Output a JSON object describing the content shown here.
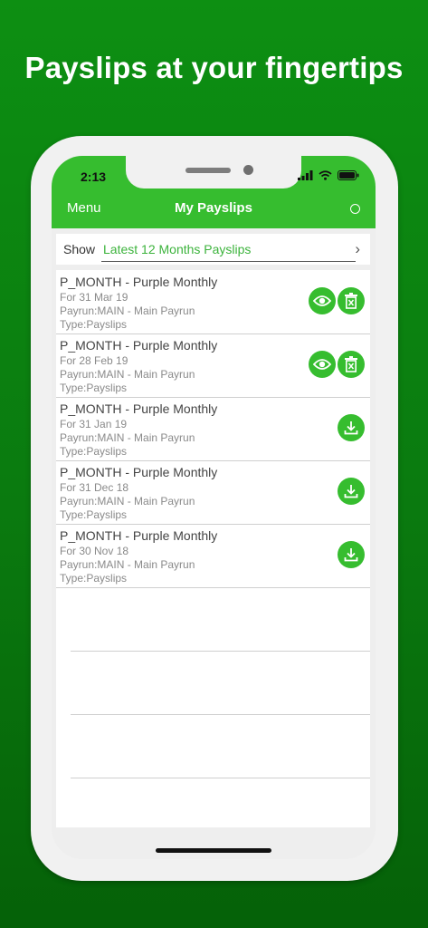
{
  "promo": {
    "headline": "Payslips at your fingertips"
  },
  "status_bar": {
    "time": "2:13",
    "icons": [
      "signal-icon",
      "wifi-icon",
      "battery-icon"
    ]
  },
  "nav": {
    "menu_label": "Menu",
    "title": "My Payslips",
    "right_icon": "refresh-icon"
  },
  "filter": {
    "label": "Show",
    "value": "Latest 12 Months Payslips",
    "chevron": "chevron-right-icon"
  },
  "payslips": [
    {
      "title": "P_MONTH - Purple Monthly",
      "date": "For 31 Mar 19",
      "payrun": "Payrun:MAIN - Main Payrun",
      "type": "Type:Payslips",
      "actions": [
        "view-icon",
        "delete-icon"
      ]
    },
    {
      "title": "P_MONTH - Purple Monthly",
      "date": "For 28 Feb 19",
      "payrun": "Payrun:MAIN - Main Payrun",
      "type": "Type:Payslips",
      "actions": [
        "view-icon",
        "delete-icon"
      ]
    },
    {
      "title": "P_MONTH - Purple Monthly",
      "date": "For 31 Jan 19",
      "payrun": "Payrun:MAIN - Main Payrun",
      "type": "Type:Payslips",
      "actions": [
        "download-icon"
      ]
    },
    {
      "title": "P_MONTH - Purple Monthly",
      "date": "For 31 Dec 18",
      "payrun": "Payrun:MAIN - Main Payrun",
      "type": "Type:Payslips",
      "actions": [
        "download-icon"
      ]
    },
    {
      "title": "P_MONTH - Purple Monthly",
      "date": "For 30 Nov 18",
      "payrun": "Payrun:MAIN - Main Payrun",
      "type": "Type:Payslips",
      "actions": [
        "download-icon"
      ]
    }
  ],
  "colors": {
    "background": "#0a7a0f",
    "accent": "#36bd2f",
    "filter_text": "#3cb33c"
  }
}
